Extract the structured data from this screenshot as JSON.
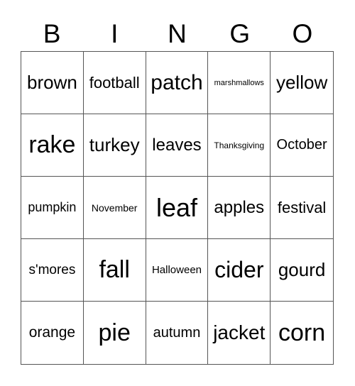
{
  "header": [
    "B",
    "I",
    "N",
    "G",
    "O"
  ],
  "cells": [
    {
      "text": "brown",
      "size": 26
    },
    {
      "text": "football",
      "size": 22
    },
    {
      "text": "patch",
      "size": 30
    },
    {
      "text": "marshmallows",
      "size": 11
    },
    {
      "text": "yellow",
      "size": 26
    },
    {
      "text": "rake",
      "size": 34
    },
    {
      "text": "turkey",
      "size": 26
    },
    {
      "text": "leaves",
      "size": 24
    },
    {
      "text": "Thanksgiving",
      "size": 12
    },
    {
      "text": "October",
      "size": 20
    },
    {
      "text": "pumpkin",
      "size": 18
    },
    {
      "text": "November",
      "size": 14
    },
    {
      "text": "leaf",
      "size": 36
    },
    {
      "text": "apples",
      "size": 24
    },
    {
      "text": "festival",
      "size": 22
    },
    {
      "text": "s'mores",
      "size": 19
    },
    {
      "text": "fall",
      "size": 34
    },
    {
      "text": "Halloween",
      "size": 15
    },
    {
      "text": "cider",
      "size": 32
    },
    {
      "text": "gourd",
      "size": 26
    },
    {
      "text": "orange",
      "size": 21
    },
    {
      "text": "pie",
      "size": 34
    },
    {
      "text": "autumn",
      "size": 20
    },
    {
      "text": "jacket",
      "size": 28
    },
    {
      "text": "corn",
      "size": 34
    }
  ]
}
